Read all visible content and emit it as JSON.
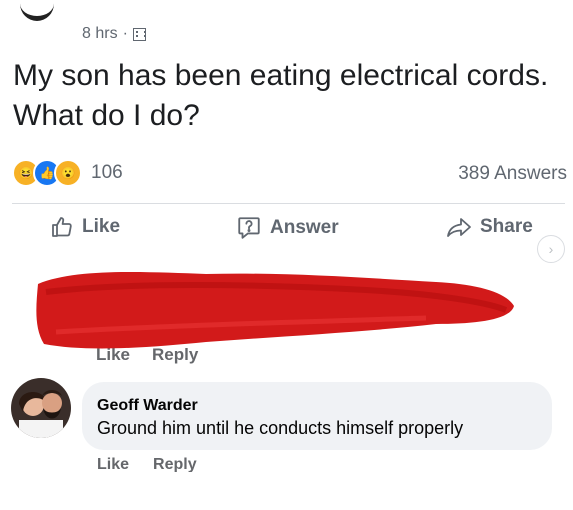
{
  "post": {
    "time": "8 hrs",
    "separator": "·",
    "audience_icon": "building-icon",
    "question": "My son has been eating electrical cords. What do I do?",
    "reaction_count": "106",
    "answers_count": "389 Answers"
  },
  "actions": {
    "like": "Like",
    "answer": "Answer",
    "share": "Share"
  },
  "redacted_comment": {
    "like": "Like",
    "reply": "Reply",
    "cover_color": "#d21a1a"
  },
  "comment": {
    "author": "Geoff Warder",
    "text": "Ground him until he conducts himself properly",
    "like": "Like",
    "reply": "Reply"
  },
  "colors": {
    "like_blue": "#1877f2",
    "meta_gray": "#606770",
    "bubble_bg": "#f0f2f5"
  }
}
